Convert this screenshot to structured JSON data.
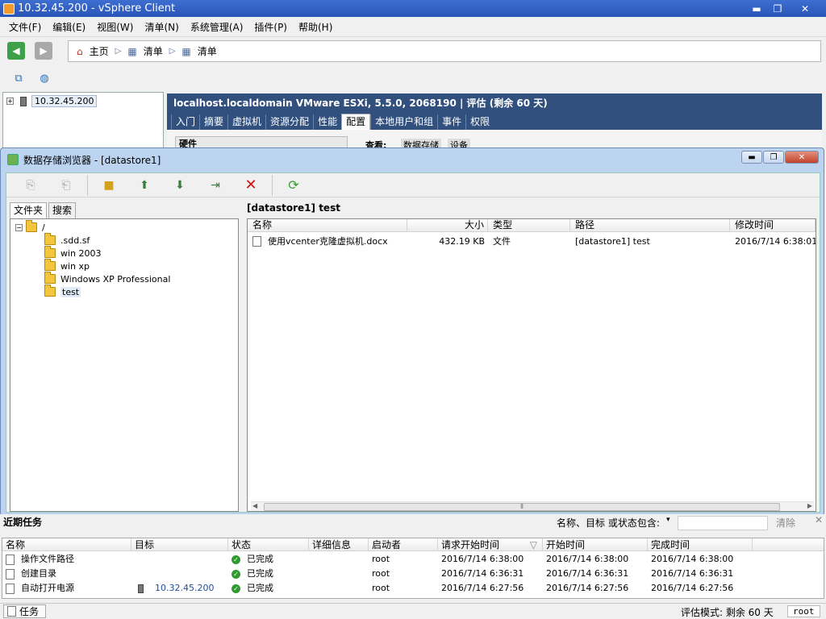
{
  "window": {
    "title": "10.32.45.200 - vSphere Client",
    "min": "▬",
    "max": "❐",
    "close": "✕"
  },
  "menu": [
    "文件(F)",
    "编辑(E)",
    "视图(W)",
    "清单(N)",
    "系统管理(A)",
    "插件(P)",
    "帮助(H)"
  ],
  "nav": {
    "home": "主页",
    "crumb1": "清单",
    "crumb2": "清单"
  },
  "inventory": {
    "host": "10.32.45.200"
  },
  "host_panel": {
    "header": "localhost.localdomain VMware ESXi, 5.5.0, 2068190 | 评估 (剩余 60 天)",
    "tabs": [
      "入门",
      "摘要",
      "虚拟机",
      "资源分配",
      "性能",
      "配置",
      "本地用户和组",
      "事件",
      "权限"
    ],
    "active_tab": "配置",
    "hardware_label": "硬件",
    "view_label": "查看:",
    "view_datastore": "数据存储",
    "view_device": "设备"
  },
  "dialog": {
    "title": "数据存储浏览器 - [datastore1]",
    "tabs": [
      "文件夹",
      "搜索"
    ],
    "tree_root": "/",
    "folders": [
      ".sdd.sf",
      "win 2003",
      "win xp",
      "Windows XP Professional",
      "test"
    ],
    "current_path": "[datastore1] test",
    "columns": [
      "名称",
      "大小",
      "类型",
      "路径",
      "修改时间"
    ],
    "files": [
      {
        "name": "使用vcenter克隆虚拟机.docx",
        "size": "432.19 KB",
        "type": "文件",
        "path": "[datastore1] test",
        "modified": "2016/7/14 6:38:01"
      }
    ]
  },
  "tasks": {
    "title": "近期任务",
    "filter_label": "名称、目标 或状态包含:",
    "clear": "清除",
    "columns": [
      "名称",
      "目标",
      "状态",
      "详细信息",
      "启动者",
      "请求开始时间",
      "开始时间",
      "完成时间"
    ],
    "rows": [
      {
        "name": "操作文件路径",
        "target": "",
        "status": "已完成",
        "details": "",
        "initiator": "root",
        "requested": "2016/7/14 6:38:00",
        "start": "2016/7/14 6:38:00",
        "end": "2016/7/14 6:38:00"
      },
      {
        "name": "创建目录",
        "target": "",
        "status": "已完成",
        "details": "",
        "initiator": "root",
        "requested": "2016/7/14 6:36:31",
        "start": "2016/7/14 6:36:31",
        "end": "2016/7/14 6:36:31"
      },
      {
        "name": "自动打开电源",
        "target": "10.32.45.200",
        "status": "已完成",
        "details": "",
        "initiator": "root",
        "requested": "2016/7/14 6:27:56",
        "start": "2016/7/14 6:27:56",
        "end": "2016/7/14 6:27:56"
      }
    ]
  },
  "status_bar": {
    "tasks": "任务",
    "eval": "评估模式: 剩余 60 天",
    "user": "root"
  },
  "colors": {
    "title_blue": "#2a55b8",
    "host_header": "#32507e",
    "folder": "#f3c63c",
    "ok_green": "#2f9a2f",
    "delete_red": "#d01010"
  }
}
